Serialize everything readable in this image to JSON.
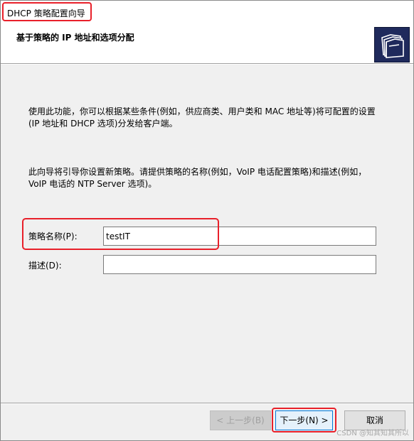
{
  "window": {
    "title": "DHCP 策略配置向导"
  },
  "header": {
    "title": "基于策略的 IP 地址和选项分配",
    "icon": "folders-icon",
    "icon_color": "#1f2a5c"
  },
  "content": {
    "paragraph1": "使用此功能，你可以根据某些条件(例如，供应商类、用户类和 MAC 地址等)将可配置的设置(IP 地址和 DHCP 选项)分发给客户端。",
    "paragraph2": "此向导将引导你设置新策略。请提供策略的名称(例如，VoIP 电话配置策略)和描述(例如，VoIP 电话的 NTP Server 选项)。"
  },
  "form": {
    "policy_name_label": "策略名称(P):",
    "policy_name_value": "testIT",
    "description_label": "描述(D):",
    "description_value": ""
  },
  "buttons": {
    "back_label": "< 上一步(B)",
    "next_label": "下一步(N) >",
    "cancel_label": "取消"
  },
  "watermark": "CSDN @知其知其所以",
  "highlight_color": "#e8202a"
}
